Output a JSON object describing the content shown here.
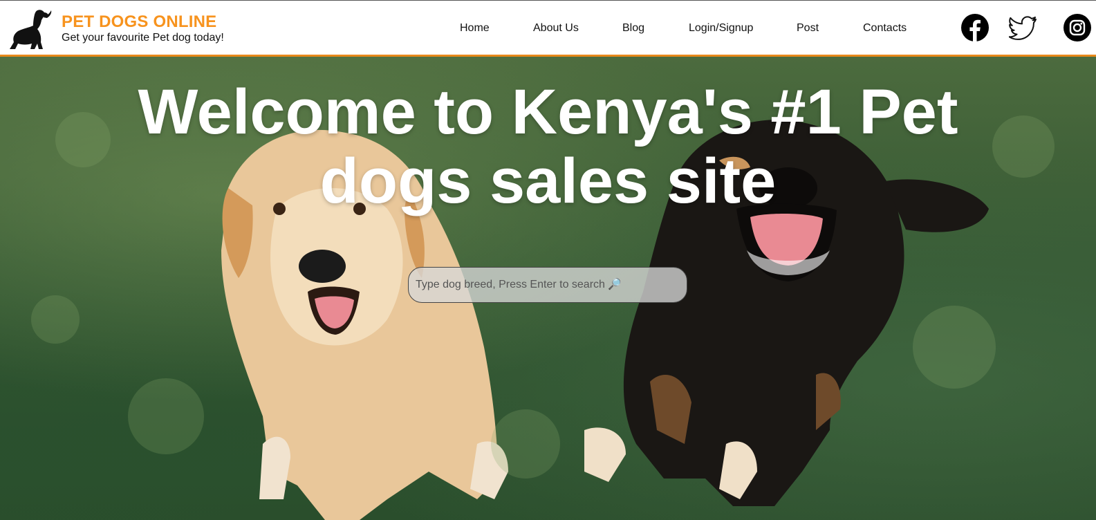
{
  "brand": {
    "title": "PET DOGS ONLINE",
    "tagline": "Get your favourite Pet dog today!",
    "accent_color": "#f7931e",
    "logo_icon": "dog-silhouette-icon"
  },
  "nav": {
    "items": [
      {
        "label": "Home"
      },
      {
        "label": "About Us"
      },
      {
        "label": "Blog"
      },
      {
        "label": "Login/Signup"
      },
      {
        "label": "Post"
      },
      {
        "label": "Contacts"
      }
    ]
  },
  "social": {
    "icons": [
      "facebook-icon",
      "twitter-icon",
      "instagram-icon"
    ]
  },
  "hero": {
    "title": "Welcome to Kenya's #1 Pet dogs sales site",
    "background": "dogs-on-grass-photo"
  },
  "search": {
    "placeholder": "Type dog breed, Press Enter to search 🔎"
  }
}
